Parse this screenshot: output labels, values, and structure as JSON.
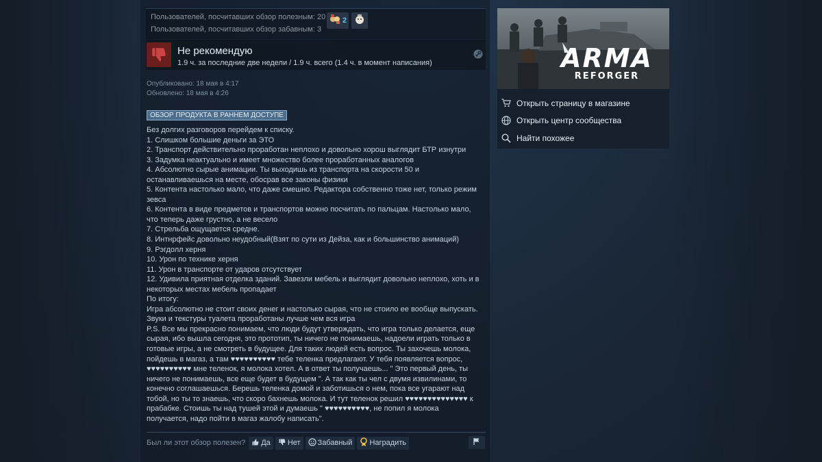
{
  "votes": {
    "helpful_line": "Пользователей, посчитавших обзор полезным: 20",
    "funny_line": "Пользователей, посчитавших обзор забавным: 3",
    "awards": [
      {
        "icon": "award-hands-icon",
        "count": "2"
      },
      {
        "icon": "award-face-icon",
        "count": ""
      }
    ]
  },
  "verdict": {
    "title": "Не рекомендую",
    "hours": "1.9 ч. за последние две недели / 1.9 ч. всего (1.4 ч. в момент написания)",
    "icon": "thumbs-down-icon",
    "color": "#6b1e1e"
  },
  "dates": {
    "published": "Опубликовано: 18 мая в 4:17",
    "updated": "Обновлено: 18 мая в 4:26"
  },
  "badge": "ОБЗОР ПРОДУКТА В РАННЕМ ДОСТУПЕ",
  "review_text": "Без долгих разговоров перейдем к списку.\n1. Слишком большие деньги за ЭТО\n2. Транспорт действительно проработан неплохо и довольно хорош выглядит БТР изнутри\n3. Задумка неактуально и имеет множество более проработанных аналогов\n4. Абсолютно сырые анимации. Ты выходишь из транспорта на скорости 50 и\nостанавливаешься на месте, обосрав все законы физики\n5. Контента настолько мало, что даже смешно. Редактора собственно тоже нет, только режим\nзевса\n6. Контента в виде предметов и транспортов можно посчитать по пальцам. Настолько мало,\nчто теперь даже грустно, а не весело\n7. Стрельба ощущается средне.\n8. Интнрфейс довольно неудобный(Взят по сути из Дейза, как и большинство анимаций)\n9. Рэгдолл херня\n10. Урон по технике херня\n11. Урон в транспорте от ударов отсутствует\n12. Удивила приятная отделка зданий. Завезли мебель и выглядит довольно неплохо, хоть и в\nнекоторых местах мебель пропадает\nПо итогу:\nИгра абсолютно не стоит своих денег и настолько сырая, что не стоило ее вообще выпускать.\nЗвуки и текстуры туалета проработаны лучше чем вся игра\nP.S. Все мы прекрасно понимаем, что люди будут утверждать, что игра только делается, еще\nсырая, ибо вышла сегодня, это прототип, ты ничего не понимаешь, надоели играть только в\nготовые игры, а не смотреть в будущее. Для таких людей есть вопрос. Ты захочешь молока,\nпойдешь в магаз, а там ♥♥♥♥♥♥♥♥♥♥ тебе теленка предлагают. У тебя появляется вопрос,\n♥♥♥♥♥♥♥♥♥♥ мне теленок, я молока хотел. А в ответ ты получаешь... \" Это первый день, ты\nничего не понимаешь, все еще будет в будущем \". А так как ты чел с двумя извилинами, то\nконечно соглашаешься. Берешь теленка домой и заботишься о нем, пока все угарают над\nтобой, но ты то знаешь, что скоро бахнешь молока. И тут теленок решил ♥♥♥♥♥♥♥♥♥♥♥♥♥♥ к\nпрабабке. Стоишь ты над тушей этой и думаешь \" ♥♥♥♥♥♥♥♥♥♥, не попил я молока\nполучается, надо пойти в магаз жалобу написать\".",
  "helpful": {
    "question": "Был ли этот обзор полезен?",
    "yes": "Да",
    "no": "Нет",
    "funny": "Забавный",
    "award": "Наградить"
  },
  "game": {
    "logo_title": "ARMA",
    "logo_subtitle": "REFORGER"
  },
  "side_links": [
    {
      "icon": "cart-icon",
      "label": "Открыть страницу в магазине"
    },
    {
      "icon": "globe-icon",
      "label": "Открыть центр сообщества"
    },
    {
      "icon": "search-icon",
      "label": "Найти похожее"
    }
  ]
}
